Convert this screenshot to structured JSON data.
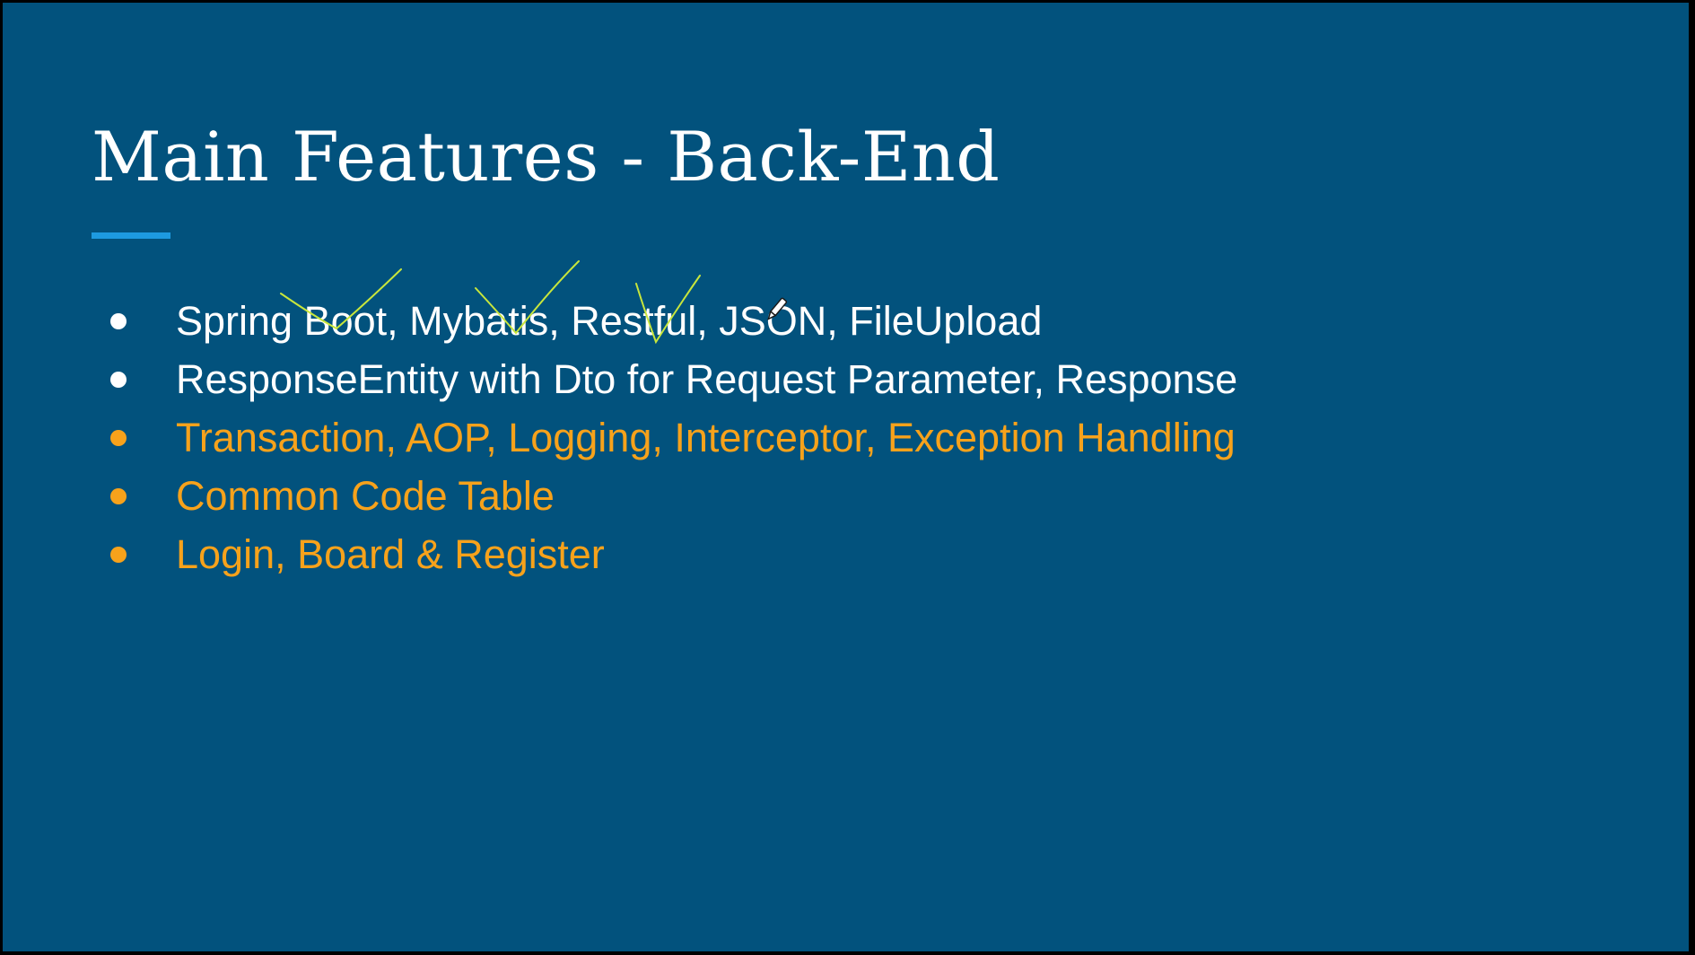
{
  "slide": {
    "title": "Main Features - Back-End",
    "accent_color": "#1d9ae0",
    "background_color": "#02527d",
    "bullets": [
      {
        "text": "Spring Boot, Mybatis, Restful, JSON, FileUpload",
        "color": "#ffffff"
      },
      {
        "text": "ResponseEntity with Dto for Request Parameter, Response",
        "color": "#ffffff"
      },
      {
        "text": "Transaction, AOP, Logging, Interceptor, Exception Handling",
        "color": "#f7a21b"
      },
      {
        "text": "Common Code Table",
        "color": "#f7a21b"
      },
      {
        "text": "Login, Board & Register",
        "color": "#f7a21b"
      }
    ]
  },
  "annotations": {
    "pen_color": "#c8e63c",
    "cursor_icon": "pen-cursor-icon"
  }
}
